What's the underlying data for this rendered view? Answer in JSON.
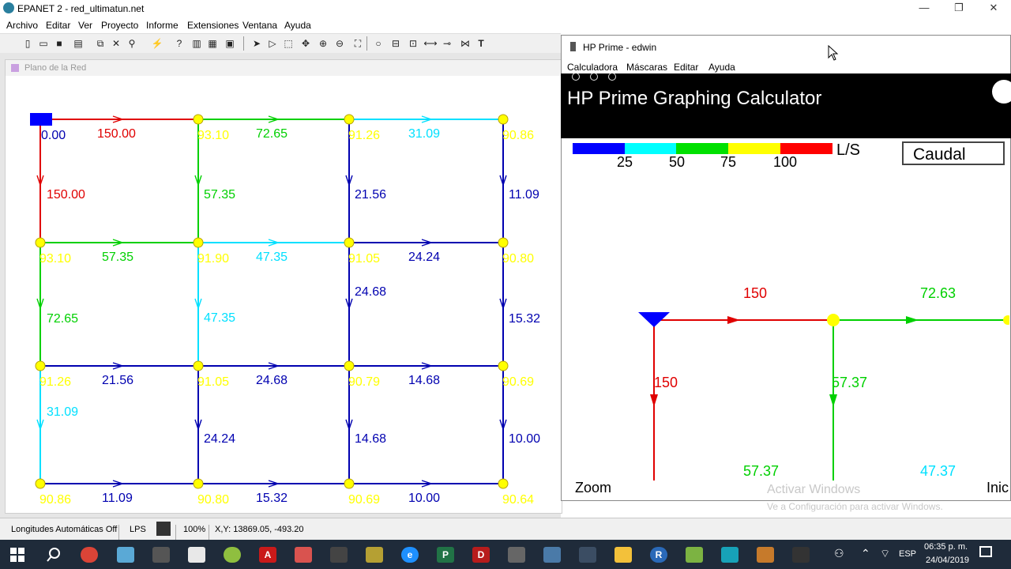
{
  "app": {
    "title": "EPANET 2 - red_ultimatun.net",
    "menu": [
      "Archivo",
      "Editar",
      "Ver",
      "Proyecto",
      "Informe",
      "Extensiones",
      "Ventana",
      "Ayuda"
    ],
    "window_buttons": {
      "minimize": "—",
      "restore": "❐",
      "close": "✕"
    }
  },
  "map_window": {
    "title": "Plano de la Red",
    "source_label": "0.00",
    "pipe_labels": [
      "150.00",
      "72.65",
      "31.09",
      "150.00",
      "57.35",
      "21.56",
      "11.09",
      "57.35",
      "47.35",
      "24.24",
      "72.65",
      "47.35",
      "24.68",
      "15.32",
      "21.56",
      "24.68",
      "14.68",
      "31.09",
      "24.24",
      "14.68",
      "10.00",
      "11.09",
      "15.32",
      "10.00"
    ],
    "node_labels": [
      "93.10",
      "91.26",
      "90.86",
      "93.10",
      "91.90",
      "91.05",
      "90.80",
      "91.26",
      "91.05",
      "90.79",
      "90.69",
      "90.86",
      "90.80",
      "90.69",
      "90.64"
    ]
  },
  "statusbar": {
    "auto_length": "Longitudes Automáticas Off",
    "units": "LPS",
    "zoom": "100%",
    "coords": "X,Y: 13869.05, -493.20"
  },
  "hp_window": {
    "title": "HP Prime - edwin",
    "menu": [
      "Calculadora",
      "Máscaras",
      "Editar",
      "Ayuda"
    ],
    "banner": "HP Prime Graphing Calculator",
    "legend": {
      "ticks": [
        "25",
        "50",
        "75",
        "100"
      ],
      "unit": "L/S",
      "colors": [
        "#0000ff",
        "#00ffff",
        "#00e000",
        "#ffff00",
        "#ff0000"
      ]
    },
    "param_box": "Caudal",
    "flow_labels": [
      "150",
      "72.63",
      "150",
      "57.37",
      "57.37",
      "47.37"
    ],
    "zoom_label": "Zoom",
    "right_label": "Inic"
  },
  "watermark": {
    "line1": "Activar Windows",
    "line2": "Ve a Configuración para activar Windows."
  },
  "taskbar": {
    "lang": "ESP",
    "time": "06:35 p. m.",
    "date": "24/04/2019"
  },
  "colors": {
    "red": "#e00000",
    "green": "#00d000",
    "cyan": "#00e0ff",
    "blue": "#0000b0",
    "yellow_node": "#ffff00"
  }
}
